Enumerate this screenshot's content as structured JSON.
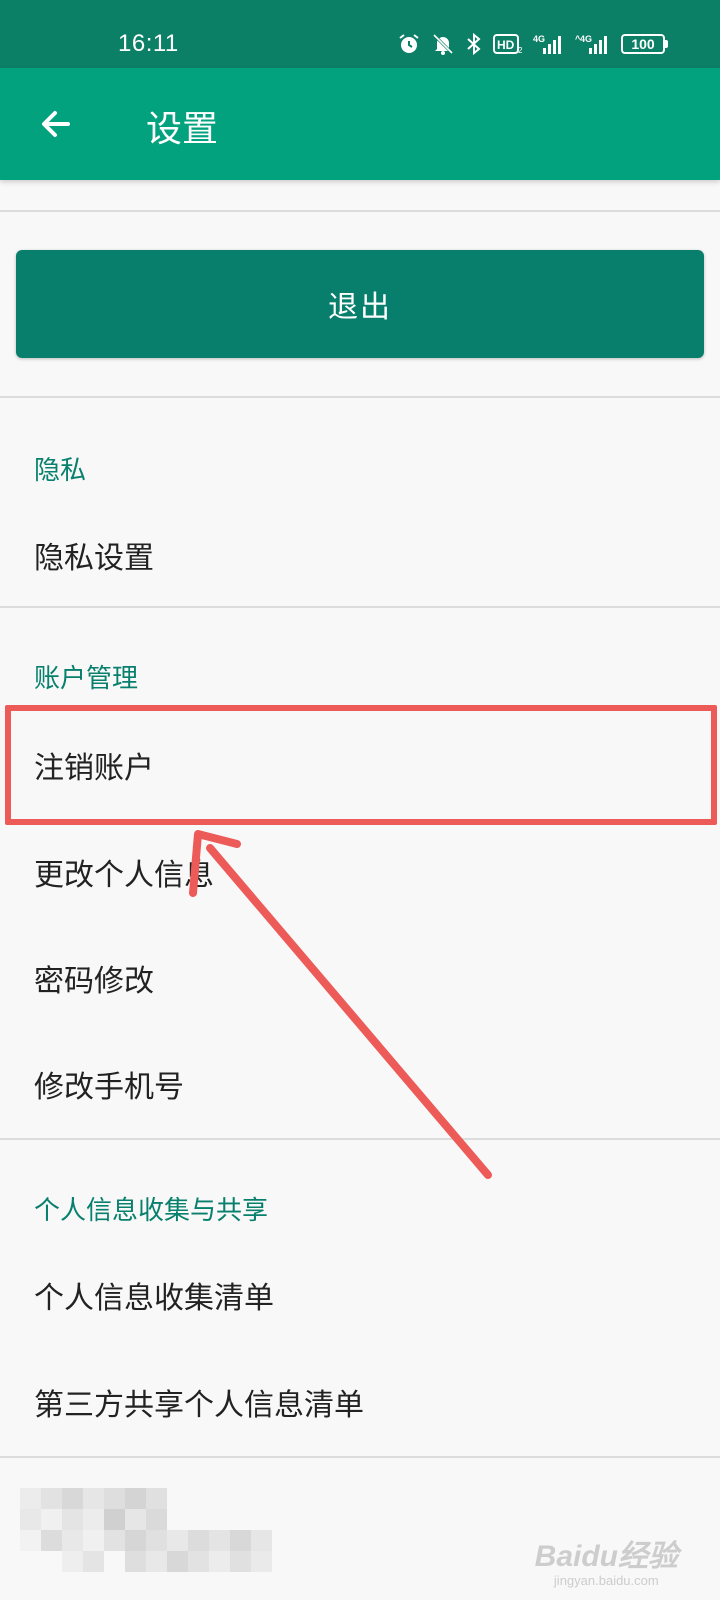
{
  "status_bar": {
    "time": "16:11",
    "battery": "100",
    "network": "4G",
    "hd_label": "HD",
    "icons": [
      "alarm-icon",
      "mute-icon",
      "bluetooth-icon",
      "hd-icon",
      "signal-4g-icon",
      "signal-4g-2-icon",
      "battery-icon"
    ]
  },
  "app_bar": {
    "title": "设置",
    "back_icon": "arrow-left-icon",
    "color": "#03a27e"
  },
  "logout_button": {
    "label": "退出",
    "color": "#087f6d"
  },
  "sections": [
    {
      "header": "隐私",
      "items": [
        "隐私设置"
      ]
    },
    {
      "header": "账户管理",
      "items": [
        "注销账户",
        "更改个人信息",
        "密码修改",
        "修改手机号"
      ]
    },
    {
      "header": "个人信息收集与共享",
      "items": [
        "个人信息收集清单",
        "第三方共享个人信息清单"
      ]
    }
  ],
  "annotation": {
    "highlight_color": "#ec5b58",
    "highlighted_item": "注销账户"
  },
  "watermark": {
    "main": "Baidu经验",
    "sub": "jingyan.baidu.com"
  }
}
